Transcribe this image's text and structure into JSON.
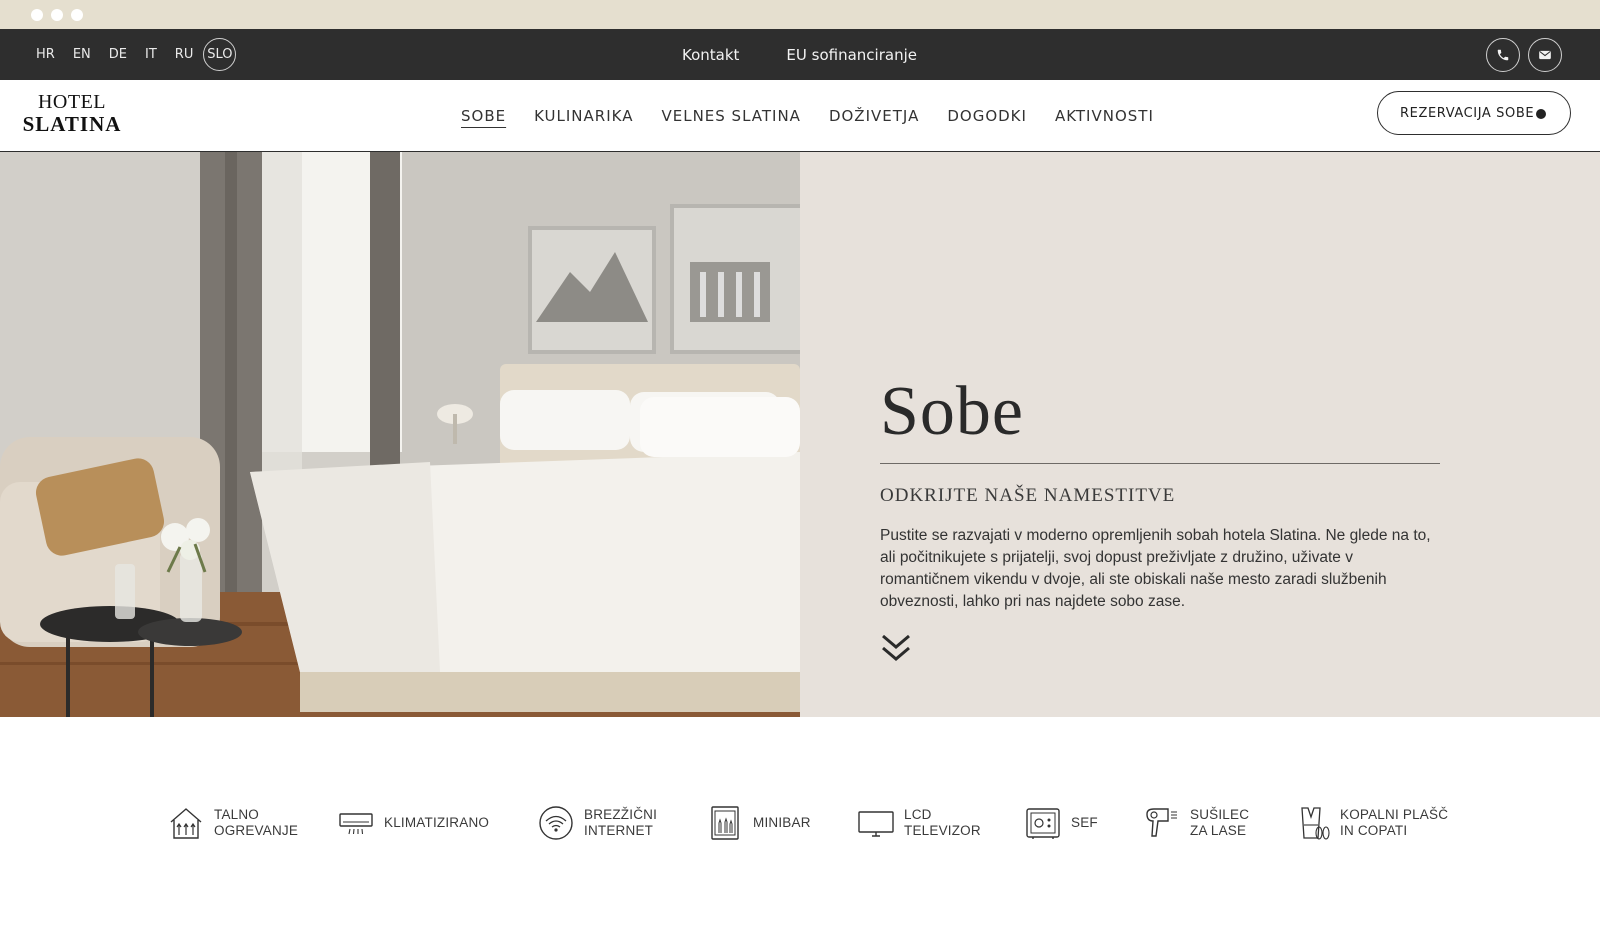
{
  "topbar": {
    "languages": [
      "HR",
      "EN",
      "DE",
      "IT",
      "RU"
    ],
    "active_language": "SLO",
    "links": {
      "contact": "Kontakt",
      "eu": "EU sofinanciranje"
    }
  },
  "logo": {
    "line1": "HOTEL",
    "line2": "SLATINA"
  },
  "nav": {
    "items": [
      "SOBE",
      "KULINARIKA",
      "VELNES SLATINA",
      "DOŽIVETJA",
      "DOGODKI",
      "AKTIVNOSTI"
    ],
    "active": "SOBE"
  },
  "reserve_button": "REZERVACIJA SOBE",
  "hero": {
    "title": "Sobe",
    "subtitle": "ODKRIJTE NAŠE NAMESTITVE",
    "text": "Pustite se razvajati v moderno opremljenih sobah hotela Slatina. Ne glede na to, ali počitnikujete s prijatelji, svoj dopust preživljate z družino, uživate v romantičnem vikendu v dvoje, ali ste obiskali naše mesto zaradi službenih obveznosti, lahko pri nas najdete sobo zase."
  },
  "amenities": [
    {
      "icon": "floor-heating-icon",
      "label": "TALNO\nOGREVANJE"
    },
    {
      "icon": "air-conditioning-icon",
      "label": "KLIMATIZIRANO"
    },
    {
      "icon": "wifi-icon",
      "label": "BREZŽIČNI\nINTERNET"
    },
    {
      "icon": "minibar-icon",
      "label": "MINIBAR"
    },
    {
      "icon": "tv-icon",
      "label": "LCD\nTELEVIZOR"
    },
    {
      "icon": "safe-icon",
      "label": "SEF"
    },
    {
      "icon": "hairdryer-icon",
      "label": "SUŠILEC\nZA LASE"
    },
    {
      "icon": "bathrobe-icon",
      "label": "KOPALNI PLAŠČ\nIN COPATI"
    }
  ]
}
